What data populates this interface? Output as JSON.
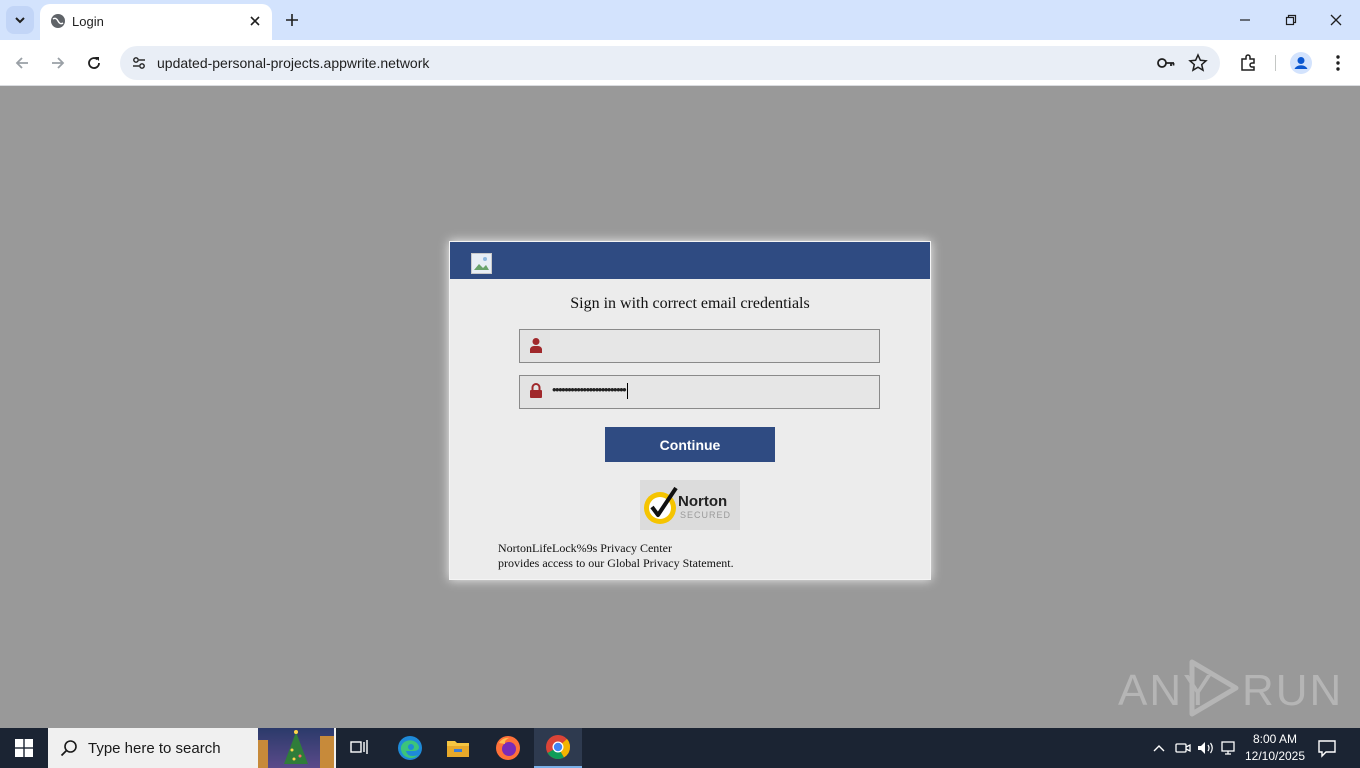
{
  "browser": {
    "tab_title": "Login",
    "url": "updated-personal-projects.appwrite.network"
  },
  "login": {
    "heading": "Sign in with correct email credentials",
    "email_value": "",
    "password_value": "••••••••••••••••••••••••",
    "continue_label": "Continue",
    "norton_brand": "Norton",
    "norton_sub": "SECURED",
    "privacy_line1": "NortonLifeLock%9s Privacy Center",
    "privacy_line2": "provides access to our Global Privacy Statement."
  },
  "watermark": {
    "left": "ANY",
    "right": "RUN"
  },
  "taskbar": {
    "search_placeholder": "Type here to search",
    "time": "8:00 AM",
    "date": "12/10/2025"
  },
  "colors": {
    "header_blue": "#2f4b82",
    "icon_red": "#a0282b",
    "page_bg": "#999999"
  },
  "icons": [
    "tab-search-icon",
    "globe-icon",
    "close-icon",
    "plus-icon",
    "minimize-icon",
    "restore-icon",
    "back-icon",
    "forward-icon",
    "reload-icon",
    "site-settings-icon",
    "key-icon",
    "star-icon",
    "extensions-icon",
    "profile-icon",
    "menu-icon",
    "user-icon",
    "lock-icon",
    "windows-icon",
    "search-icon",
    "task-view-icon",
    "edge-icon",
    "file-explorer-icon",
    "firefox-icon",
    "chrome-icon"
  ]
}
